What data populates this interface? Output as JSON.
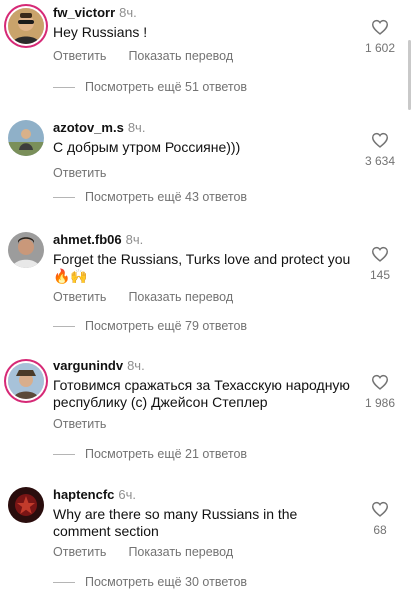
{
  "comments": [
    {
      "username": "fw_victorr",
      "time": "8ч.",
      "text": "Hey Russians !",
      "actions": [
        "Ответить",
        "Показать перевод"
      ],
      "replies": "Посмотреть ещё 51 ответов",
      "likes": "1 602",
      "avatar": "avatar-man-sunglasses"
    },
    {
      "username": "azotov_m.s",
      "time": "8ч.",
      "text": "С добрым утром Россияне)))",
      "actions": [
        "Ответить"
      ],
      "replies": "Посмотреть ещё 43 ответов",
      "likes": "3 634",
      "avatar": "avatar-person-outdoors"
    },
    {
      "username": "ahmet.fb06",
      "time": "8ч.",
      "text": "Forget the Russians, Turks love and protect you🔥🙌",
      "actions": [
        "Ответить",
        "Показать перевод"
      ],
      "replies": "Посмотреть ещё 79 ответов",
      "likes": "145",
      "avatar": "avatar-man-portrait"
    },
    {
      "username": "vargunindv",
      "time": "8ч.",
      "text": "Готовимся сражаться за Техасскую народную республику (с) Джейсон Степлер",
      "actions": [
        "Ответить"
      ],
      "replies": "Посмотреть ещё 21 ответов",
      "likes": "1 986",
      "avatar": "avatar-person-hat"
    },
    {
      "username": "haptencfc",
      "time": "6ч.",
      "text": "Why are there so many Russians in the comment section",
      "actions": [
        "Ответить",
        "Показать перевод"
      ],
      "replies": "Посмотреть ещё 30 ответов",
      "likes": "68",
      "avatar": "avatar-dark-red-logo"
    }
  ],
  "colors": {
    "text": "#111111",
    "secondary": "#737373",
    "story_ring": "#d62976"
  },
  "icons": {
    "like": "heart-outline-icon"
  }
}
